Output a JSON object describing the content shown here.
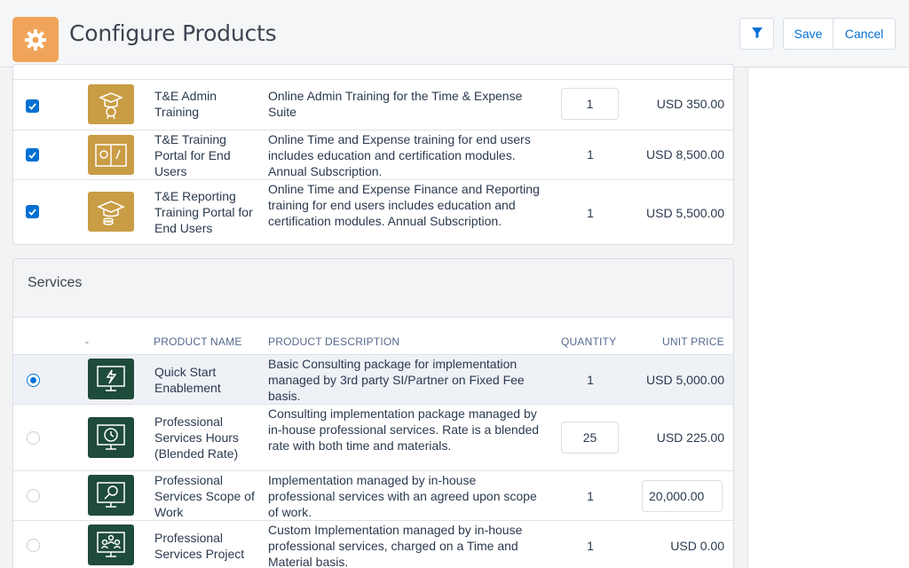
{
  "header": {
    "title": "Configure Products",
    "app_icon": "gear-icon",
    "filter_icon": "filter-icon",
    "save_label": "Save",
    "cancel_label": "Cancel",
    "accent_color": "#f0a45a"
  },
  "training_section": {
    "rows": [
      {
        "checked": true,
        "icon": "training-certificate-icon",
        "name": "T&E Admin Training",
        "description": "Online Admin Training for the Time & Expense Suite",
        "quantity": "1",
        "unit_price": "USD 350.00"
      },
      {
        "checked": true,
        "icon": "training-portal-icon",
        "name": "T&E Training Portal for End Users",
        "description": "Online Time and Expense training for end users includes education and certification modules. Annual Subscription.",
        "quantity": "1",
        "unit_price": "USD 8,500.00"
      },
      {
        "checked": true,
        "icon": "graduation-cap-icon",
        "name": "T&E Reporting Training Portal for End Users",
        "description": "Online Time and Expense Finance and Reporting training for end users includes education and certification modules. Annual Subscription.",
        "quantity": "1",
        "unit_price": "USD 5,500.00"
      }
    ]
  },
  "services_section": {
    "title": "Services",
    "columns": {
      "icon": "-",
      "name": "PRODUCT NAME",
      "description": "PRODUCT DESCRIPTION",
      "quantity": "QUANTITY",
      "unit_price": "UNIT PRICE"
    },
    "rows": [
      {
        "selected": true,
        "icon": "monitor-lightning-icon",
        "name": "Quick Start Enablement",
        "description": "Basic Consulting package for implementation managed by 3rd party SI/Partner on Fixed Fee basis.",
        "quantity": "1",
        "unit_price": "USD 5,000.00"
      },
      {
        "selected": false,
        "icon": "monitor-clock-icon",
        "name": "Professional Services Hours (Blended Rate)",
        "description": "Consulting implementation package managed by in-house professional services. Rate is a blended rate with both time and materials.",
        "quantity": "25",
        "unit_price": "USD 225.00"
      },
      {
        "selected": false,
        "icon": "monitor-search-icon",
        "name": "Professional Services Scope of Work",
        "description": "Implementation managed by in-house professional services with an agreed upon scope of work.",
        "quantity": "1",
        "unit_price": "20,000.00"
      },
      {
        "selected": false,
        "icon": "monitor-team-icon",
        "name": "Professional Services Project",
        "description": "Custom Implementation managed by in-house professional services, charged on a Time and Material basis.",
        "quantity": "1",
        "unit_price": "USD 0.00"
      }
    ]
  }
}
